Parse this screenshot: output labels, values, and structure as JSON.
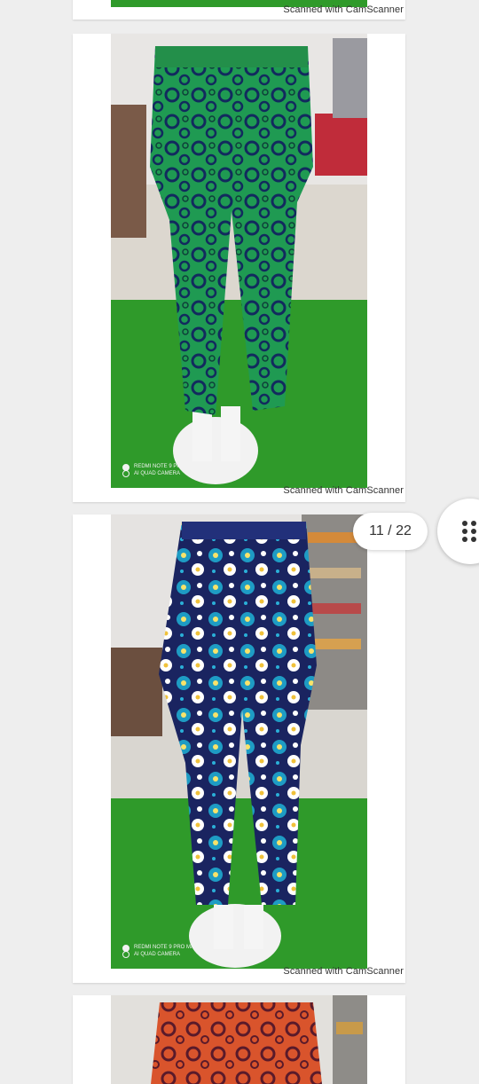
{
  "viewer": {
    "page_counter": "11 / 22",
    "grid_icon": "grid-dots-icon"
  },
  "pages": [
    {
      "watermark": "Scanned with CamScanner"
    },
    {
      "watermark": "Scanned with CamScanner",
      "camera_line1": "REDMI NOTE 9 PRO MAX",
      "camera_line2": "AI QUAD CAMERA"
    },
    {
      "watermark": "Scanned with CamScanner",
      "camera_line1": "REDMI NOTE 9 PRO MAX",
      "camera_line2": "AI QUAD CAMERA"
    }
  ],
  "colors": {
    "background": "#eeeeee",
    "grass": "#2f9a2a",
    "green_print": "#1f9a52",
    "blue_print": "#1c2a66",
    "orange_print": "#d9542c"
  }
}
